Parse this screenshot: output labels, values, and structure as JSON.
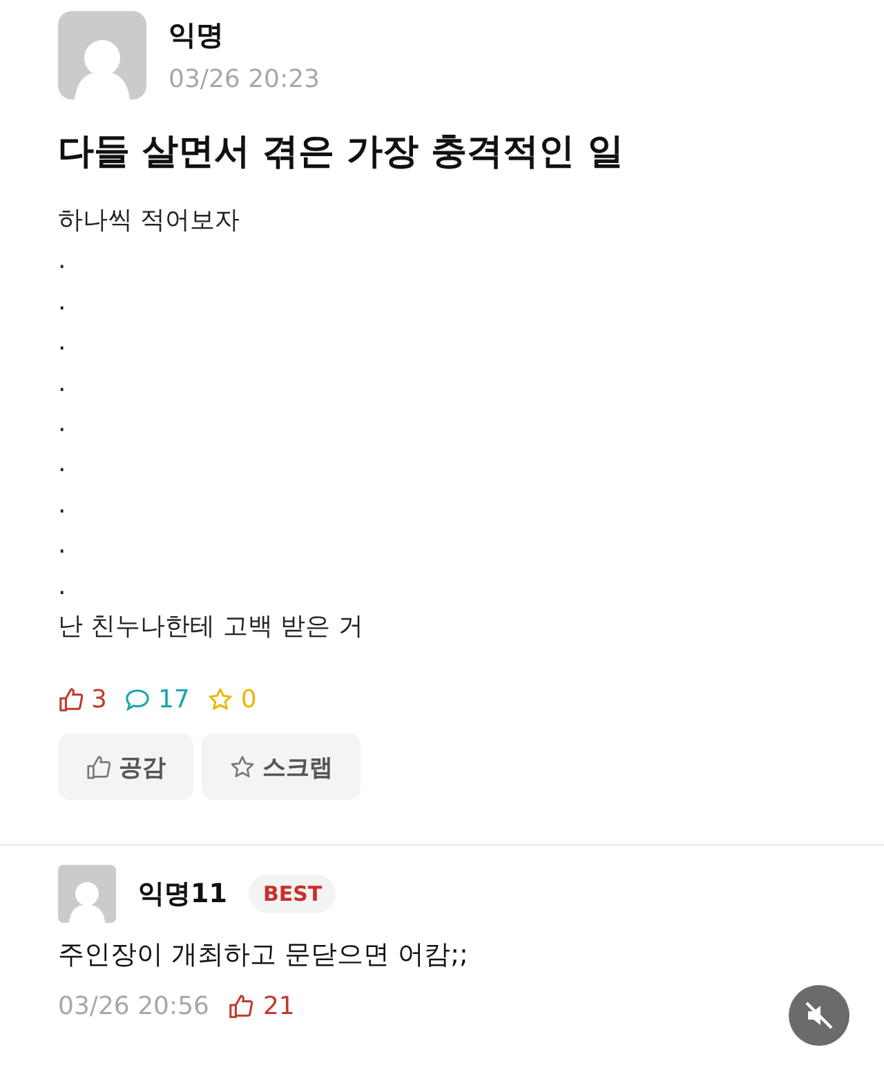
{
  "post": {
    "author": "익명",
    "time": "03/26 20:23",
    "title": "다들 살면서 겪은 가장 충격적인 일",
    "body": [
      "하나씩 적어보자",
      ".",
      ".",
      ".",
      ".",
      ".",
      ".",
      ".",
      ".",
      ".",
      "난 친누나한테 고백 받은 거"
    ],
    "stats": {
      "likes": "3",
      "comments": "17",
      "scraps": "0"
    },
    "buttons": [
      {
        "kind": "like",
        "label": "공감"
      },
      {
        "kind": "scrap",
        "label": "스크랩"
      }
    ]
  },
  "comments": [
    {
      "author": "익명11",
      "badge": "BEST",
      "text": "주인장이 개최하고 문닫으면 어캄;;",
      "time": "03/26 20:56",
      "likes": "21"
    }
  ],
  "mute_button": {
    "muted": true
  }
}
